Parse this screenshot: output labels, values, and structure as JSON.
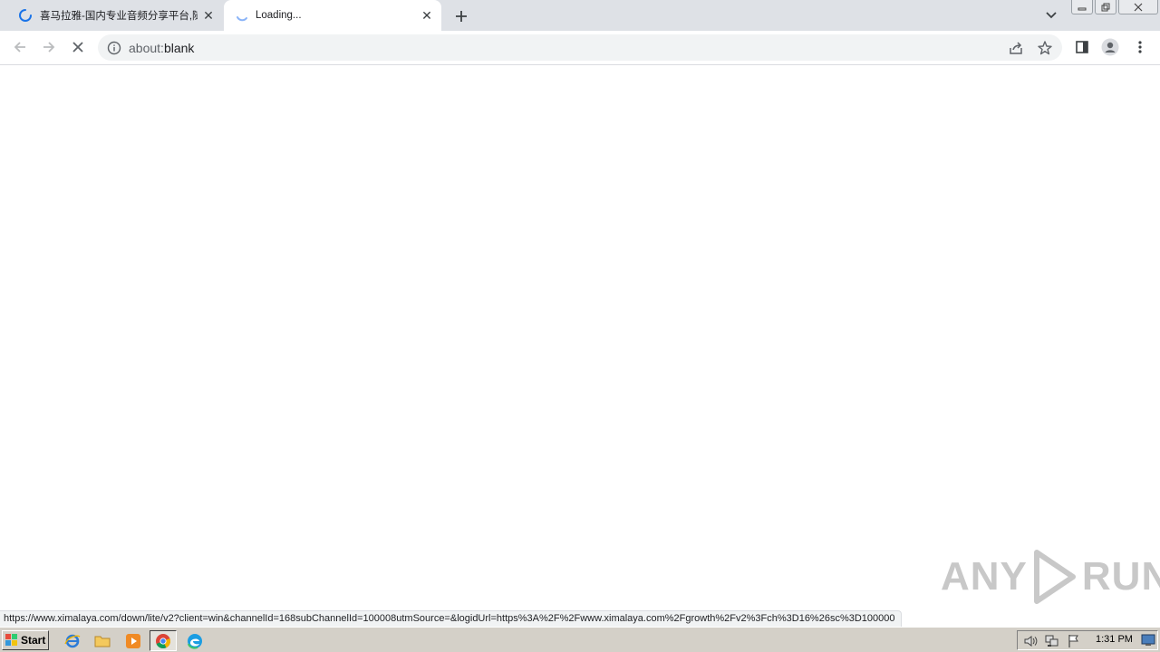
{
  "tabs": [
    {
      "title": "喜马拉雅-国内专业音频分享平台,随",
      "state": "loading"
    },
    {
      "title": "Loading...",
      "state": "loading",
      "active": true
    }
  ],
  "toolbar": {
    "url_scheme": "about:",
    "url_rest": "blank"
  },
  "status_url": "https://www.ximalaya.com/down/lite/v2?client=win&channelId=168subChannelId=100008utmSource=&logidUrl=https%3A%2F%2Fwww.ximalaya.com%2Fgrowth%2Fv2%3Fch%3D16%26sc%3D100000",
  "watermark": {
    "left": "ANY",
    "right": "RUN"
  },
  "taskbar": {
    "start_label": "Start",
    "clock": "1:31 PM"
  },
  "colors": {
    "tabstrip": "#dee1e6",
    "omnibox": "#f1f3f4",
    "spinner": "#1a73e8",
    "taskbar": "#d4d0c8"
  }
}
